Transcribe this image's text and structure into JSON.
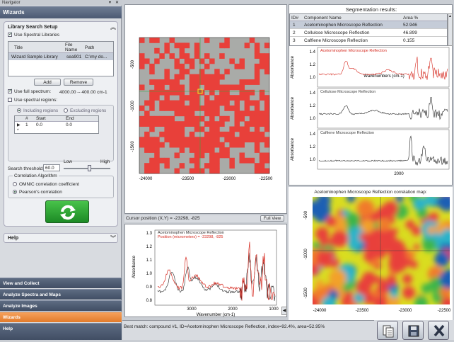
{
  "navigator": {
    "title": "Navigator",
    "header": "Wizards",
    "library_section": {
      "title": "Library Search Setup",
      "use_spectral_libraries": "Use Spectral Libraries",
      "columns": [
        "Title",
        "File Name",
        "Path"
      ],
      "row": [
        "Wizard Sample Library",
        "sea901",
        "C:\\my do..."
      ],
      "add_label": "Add",
      "remove_label": "Remove",
      "use_full_spectrum": "Use full spectrum:",
      "full_spectrum_range": "4000.00 -- 400.00 cm-1",
      "use_spectral_regions": "Use spectral regions:",
      "including_regions": "Including regions",
      "excluding_regions": "Excluding regions",
      "regions_columns": [
        "#",
        "Start",
        "End"
      ],
      "regions_row": [
        "1",
        "0.0",
        "0.0"
      ],
      "new_row_marker": "*",
      "search_threshold_label": "Search threshold:",
      "search_threshold_value": "60.0",
      "slider_low": "Low",
      "slider_high": "High",
      "slider_fraction": 0.55,
      "correlation_title": "Correlation Algorithm",
      "omnic_label": "OMNIC correlation coefficient",
      "pearson_label": "Pearson's correlation"
    },
    "help_panel": "Help",
    "bottom_items": [
      {
        "label": "View and Collect"
      },
      {
        "label": "Analyze Spectra and Maps"
      },
      {
        "label": "Analyze Images"
      },
      {
        "label": "Wizards"
      },
      {
        "label": "Help"
      }
    ]
  },
  "map_panel": {
    "x_ticks": [
      "-24000",
      "-23500",
      "-23000",
      "-22500"
    ],
    "y_ticks": [
      "-500",
      "-1000",
      "-1500"
    ],
    "cursor_label": "Cursor position (X,Y) = -23298, -825",
    "full_view_label": "Full View"
  },
  "spectrum_panel": {
    "ylabel": "Absorbance",
    "xlabel": "Wavenumber (cm-1)",
    "legend_1": "Acetominophen Microscope Reflection",
    "legend_2": "Position (micrometers) = -23298, -825",
    "y_ticks": [
      "1.3",
      "1.2",
      "1.1",
      "1.0",
      "0.9",
      "0.8"
    ],
    "x_ticks": [
      "3000",
      "2000",
      "1000"
    ]
  },
  "segmentation": {
    "title": "Segmentation results:",
    "columns": [
      "ID#",
      "Component Name",
      "Area %"
    ],
    "rows": [
      {
        "id": "1",
        "name": "Acetominophen Microscope Reflection",
        "area": "52.946"
      },
      {
        "id": "2",
        "name": "Cellulose Microscope Reflection",
        "area": "46.899"
      },
      {
        "id": "3",
        "name": "Caffiene Microscope Reflection",
        "area": "0.155"
      }
    ],
    "spectra": [
      {
        "name": "Acetominophen Microscope Reflection",
        "ticks": [
          "1.4",
          "1.2",
          "1.0"
        ]
      },
      {
        "name": "Cellulose Microscope Reflection",
        "ticks": [
          "1.4",
          "1.2",
          "1.0"
        ]
      },
      {
        "name": "Caffiene Microscope Reflection",
        "ticks": [
          "1.4",
          "1.2",
          "1.0"
        ]
      }
    ],
    "ylabel": "Absorbance",
    "xlabel": "Wavenumbers (cm-1)",
    "x_tick": "2000"
  },
  "correlation_map": {
    "title": "Acetominophen Microscope Reflection correlation map:",
    "x_ticks": [
      "-24000",
      "-23500",
      "-23000",
      "-22500"
    ],
    "y_ticks": [
      "-500",
      "-1000",
      "-1500"
    ]
  },
  "status": {
    "best_match": "Best match: compound #1, ID=Acetominophen Microscope Reflection, index=92.4%, area=52.95%"
  },
  "colors": {
    "accent_orange": "#e8842f",
    "map_red": "#e8403a",
    "spectrum_red": "#d62a20"
  }
}
